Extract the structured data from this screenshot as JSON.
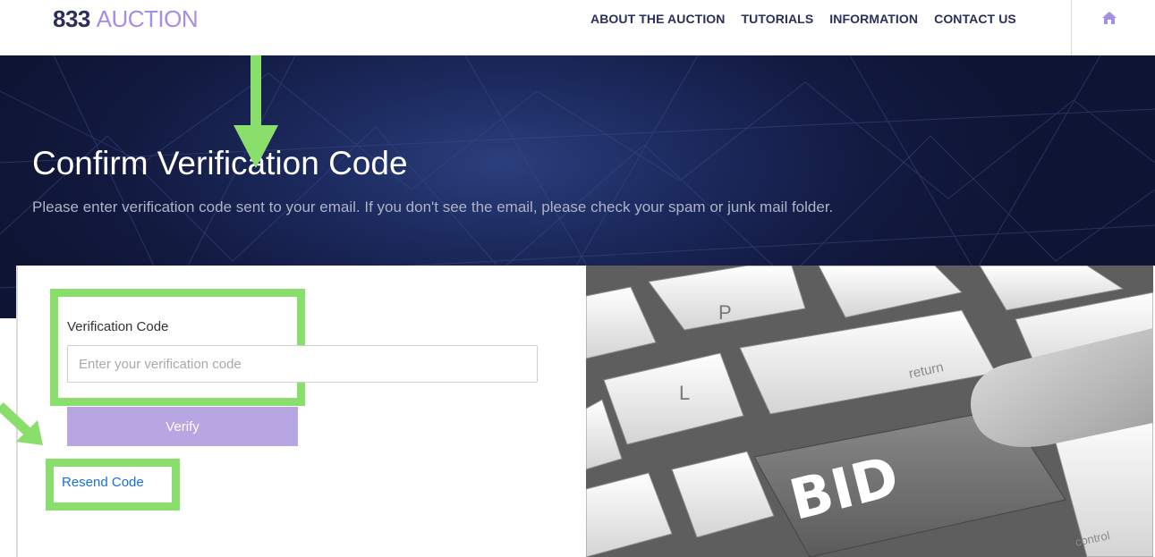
{
  "header": {
    "logo_number": "833",
    "logo_word": "AUCTION",
    "nav": [
      "ABOUT THE AUCTION",
      "TUTORIALS",
      "INFORMATION",
      "CONTACT US"
    ],
    "home_icon": "home-icon"
  },
  "hero": {
    "title": "Confirm Verification Code",
    "subtitle": "Please enter verification code sent to your email. If you don't see the email, please check your spam or junk mail folder."
  },
  "form": {
    "label": "Verification Code",
    "placeholder": "Enter your verification code",
    "value": "",
    "verify_label": "Verify",
    "resend_label": "Resend Code"
  },
  "image": {
    "key_letters": [
      "P",
      "L"
    ],
    "return_key": "return",
    "bid_key": "BID",
    "control_key": "control"
  },
  "colors": {
    "brand_dark": "#2b2f5a",
    "brand_purple": "#a48ee6",
    "button": "#b8a6e3",
    "link": "#1b6fd8",
    "highlight": "#8ade6b"
  }
}
